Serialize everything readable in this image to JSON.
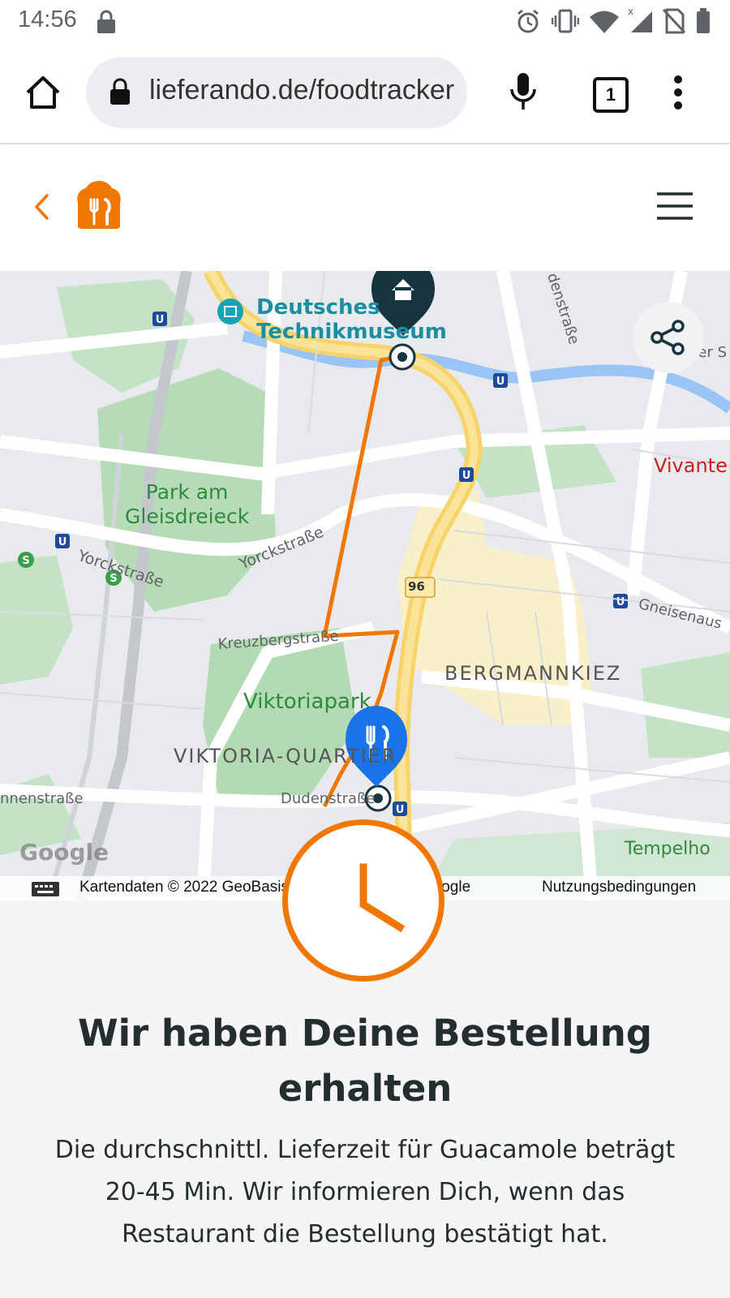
{
  "status_bar": {
    "time": "14:56"
  },
  "browser": {
    "url": "lieferando.de/foodtracker",
    "tab_count": "1"
  },
  "map": {
    "labels": {
      "museum": "Deutsches Technikmuseum",
      "museum_line1": "Deutsches",
      "museum_line2": "Technikmuseum",
      "park1_line1": "Park am",
      "park1_line2": "Gleisdreieck",
      "yorck1": "Yorckstraße",
      "yorck2": "Yorckstraße",
      "kreuzberg": "Kreuzbergstraße",
      "viktoriapark": "Viktoriapark",
      "viktoria_quartier": "VIKTORIA-QUARTIER",
      "bergmannkiez": "BERGMANNKIEZ",
      "dudenstrasse": "Dudenstraße",
      "monnenstrasse": "nnenstraße",
      "gneisenau": "Gneisenaus",
      "vivante": "Vivante",
      "denstrasse": "denstraße",
      "tempelhof": "Tempelho",
      "iner": "iner S",
      "road_96": "96"
    },
    "attribution": "Kartendaten © 2022 GeoBasis-DE/BKG (©2009), Google",
    "terms": "Nutzungsbedingungen",
    "google_logo": "Google"
  },
  "order": {
    "headline": "Wir haben Deine Bestellung erhalten",
    "description": "Die durchschnittl. Lieferzeit für Guacamole beträgt 20-45 Min. Wir informieren Dich, wenn das Restaurant die Bestellung bestätigt hat."
  },
  "colors": {
    "brand": "#f27700",
    "text": "#242e30",
    "home_pin": "#17343f",
    "restaurant_pin": "#1a73e8"
  }
}
